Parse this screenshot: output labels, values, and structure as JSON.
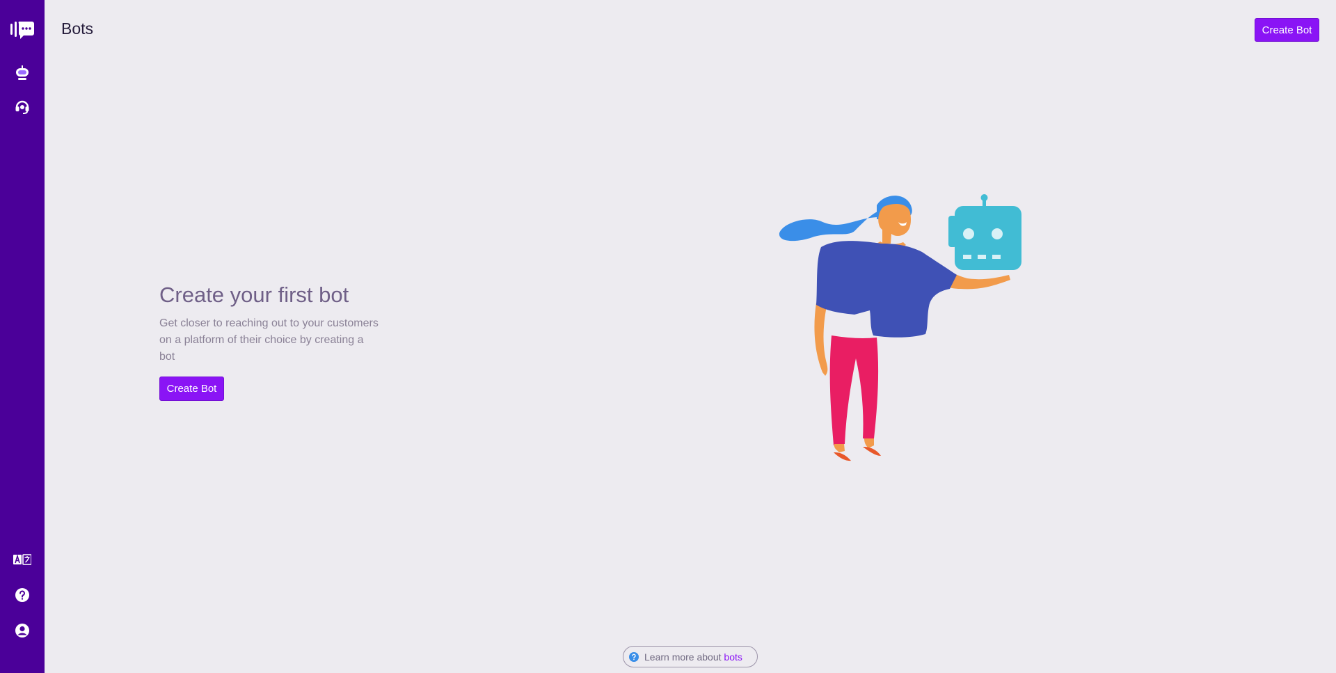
{
  "header": {
    "title": "Bots",
    "create_button": "Create Bot"
  },
  "sidebar": {
    "logo": "chatwoot-logo-icon",
    "items": [
      {
        "name": "bots",
        "icon": "robot-icon"
      },
      {
        "name": "agent-bots",
        "icon": "headset-icon"
      }
    ],
    "bottom_items": [
      {
        "name": "language",
        "icon": "translate-icon"
      },
      {
        "name": "help",
        "icon": "help-icon"
      },
      {
        "name": "profile",
        "icon": "user-icon"
      }
    ]
  },
  "empty_state": {
    "title": "Create your first bot",
    "description": "Get closer to reaching out to your customers on a platform of their choice by creating a bot",
    "create_button": "Create Bot"
  },
  "learn_more": {
    "prefix": "Learn more about",
    "link": "bots"
  },
  "colors": {
    "sidebar": "#4b0099",
    "accent": "#8a14f5",
    "background": "#edebf0",
    "robot": "#41bcd4",
    "hair": "#3a8ee8",
    "shirt": "#3f51b5",
    "pants": "#e91e63",
    "skin": "#f29b4b"
  }
}
